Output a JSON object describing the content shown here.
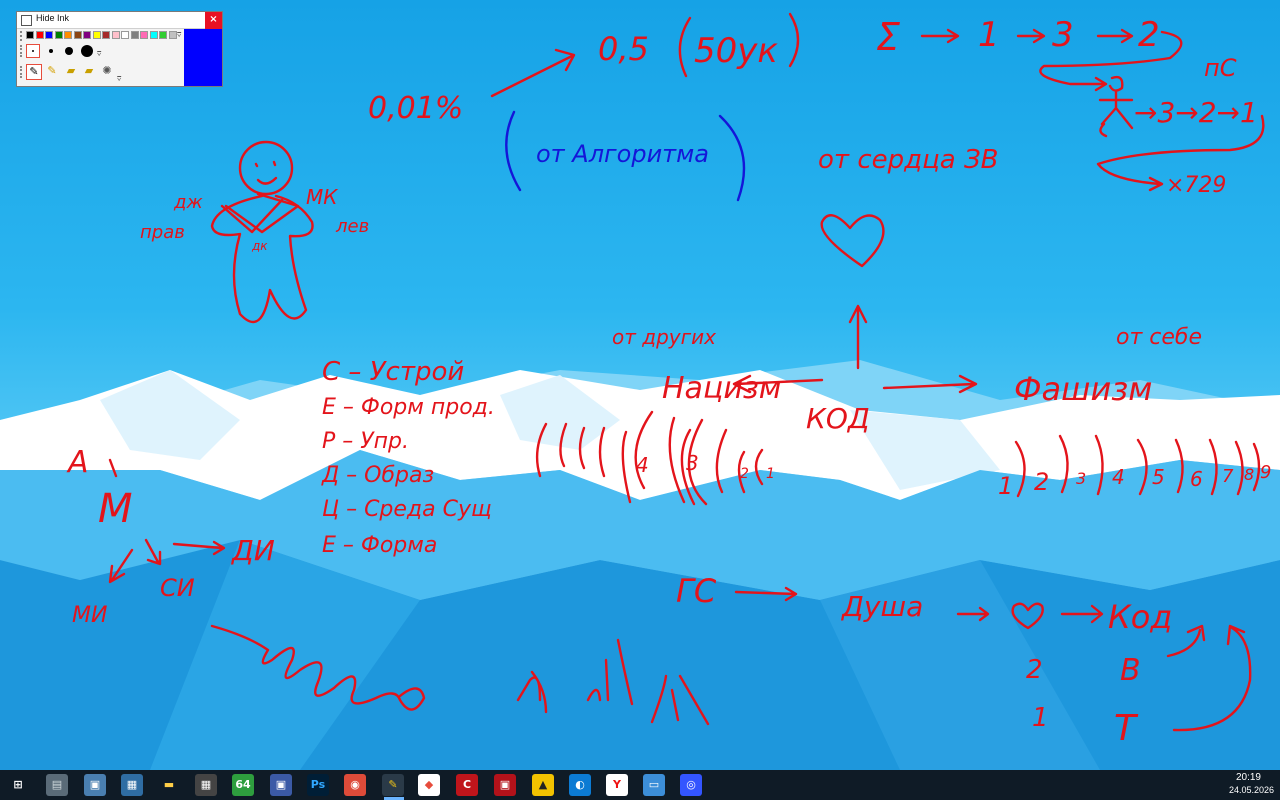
{
  "toolbar": {
    "title": "Hide Ink",
    "close_glyph": "×",
    "colors": [
      "#000000",
      "#ff0000",
      "#0000ff",
      "#008000",
      "#ff8c00",
      "#8b4513",
      "#800080",
      "#ffff00",
      "#a52a2a",
      "#ffc0cb",
      "#ffffff",
      "#808080",
      "#ff69b4",
      "#00ffff",
      "#32cd32",
      "#c0c0c0"
    ],
    "current_color": "#0000ff",
    "tools": [
      "pen-icon",
      "highlighter-icon",
      "eraser-icon",
      "eraser-all-icon",
      "clear-icon"
    ]
  },
  "ink": {
    "pct": "0,01%",
    "half": "0,5",
    "fifty": "50ук",
    "algorithm": "от Алгоритма",
    "sigma": "Σ",
    "seq_1": "1",
    "seq_3": "3",
    "seq_2": "2",
    "pc": "пС",
    "arrow_seq": "→3→2→1",
    "x729": "×729",
    "heart_text": "от сердца ЗВ",
    "dzh": "дж",
    "mk": "МК",
    "prav": "прав",
    "lev": "лев",
    "dk": "дк",
    "c_line": "С – Устрой",
    "e_line": "Е – Форм прод.",
    "r_line": "Р – Упр.",
    "d_line": "Д – Образ",
    "ts_line": "Ц – Среда Сущ",
    "e2_line": "Е – Форма",
    "a": "А",
    "m": "М",
    "di": "ДИ",
    "mi": "МИ",
    "si": "СИ",
    "from_friends": "от других",
    "nazism": "Нацизм",
    "kod": "КОД",
    "from_self": "от себе",
    "fascism": "Фашизм",
    "nums": [
      "1",
      "2",
      "3",
      "4",
      "5",
      "6",
      "7",
      "8",
      "9"
    ],
    "paren_nums": [
      "4",
      "3",
      "2",
      "1"
    ],
    "gs": "ГС",
    "dusha": "Душа",
    "kod2": "Код",
    "two": "2",
    "one": "1",
    "v": "В",
    "t": "Т"
  },
  "taskbar": {
    "items": [
      {
        "name": "start-icon",
        "glyph": "⊞",
        "color": "#ffffff",
        "bg": "transparent"
      },
      {
        "name": "app-icon-1",
        "glyph": "▤",
        "color": "#cfd8dc",
        "bg": "#5a6b78"
      },
      {
        "name": "app-icon-2",
        "glyph": "▣",
        "color": "#ffffff",
        "bg": "#4a7fb0"
      },
      {
        "name": "app-icon-3",
        "glyph": "▦",
        "color": "#ffffff",
        "bg": "#2f6da3"
      },
      {
        "name": "file-explorer-icon",
        "glyph": "▬",
        "color": "#ffcf48",
        "bg": "transparent"
      },
      {
        "name": "calculator-icon",
        "glyph": "▦",
        "color": "#ffffff",
        "bg": "#444"
      },
      {
        "name": "app-64-icon",
        "glyph": "64",
        "color": "#ffffff",
        "bg": "#2e9e3e"
      },
      {
        "name": "save-icon",
        "glyph": "▣",
        "color": "#ffffff",
        "bg": "#3b5aa6"
      },
      {
        "name": "photoshop-icon",
        "glyph": "Ps",
        "color": "#31a8ff",
        "bg": "#001e36"
      },
      {
        "name": "chrome-icon",
        "glyph": "◉",
        "color": "#ffffff",
        "bg": "#dd4b39"
      },
      {
        "name": "ink-pen-icon",
        "glyph": "✎",
        "color": "#f0c419",
        "bg": "#2a3a48"
      },
      {
        "name": "app-icon-4",
        "glyph": "◆",
        "color": "#e74c3c",
        "bg": "#ffffff"
      },
      {
        "name": "app-icon-5",
        "glyph": "C",
        "color": "#ffffff",
        "bg": "#c0151b"
      },
      {
        "name": "app-icon-6",
        "glyph": "▣",
        "color": "#ffffff",
        "bg": "#b3121a"
      },
      {
        "name": "app-icon-7",
        "glyph": "▲",
        "color": "#222",
        "bg": "#f2c200"
      },
      {
        "name": "edge-icon",
        "glyph": "◐",
        "color": "#ffffff",
        "bg": "#0c7bd3"
      },
      {
        "name": "yandex-browser-icon",
        "glyph": "Y",
        "color": "#e11",
        "bg": "#ffffff"
      },
      {
        "name": "remote-desktop-icon",
        "glyph": "▭",
        "color": "#ffffff",
        "bg": "#3c8ed8"
      },
      {
        "name": "app-icon-8",
        "glyph": "◎",
        "color": "#ffffff",
        "bg": "#3355ff"
      }
    ],
    "time": "20:19",
    "date": "24.05.2026"
  }
}
